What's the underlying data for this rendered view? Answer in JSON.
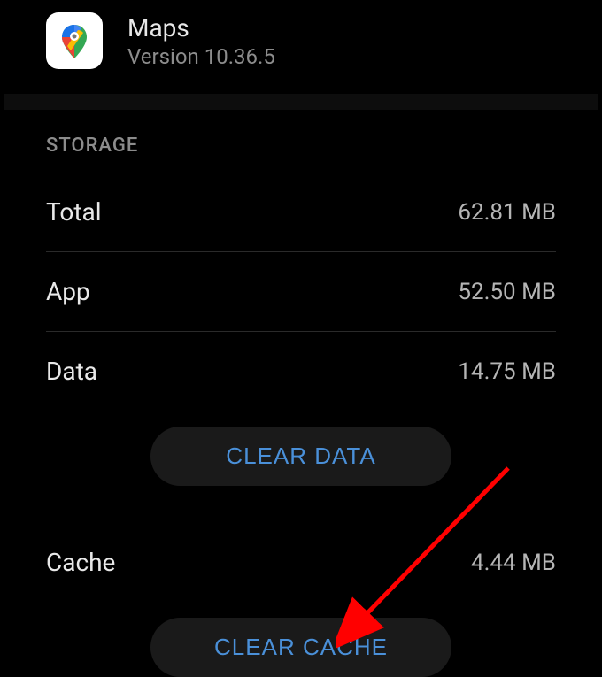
{
  "header": {
    "app_name": "Maps",
    "version_text": "Version 10.36.5"
  },
  "section": {
    "title": "STORAGE"
  },
  "storage": {
    "total_label": "Total",
    "total_value": "62.81 MB",
    "app_label": "App",
    "app_value": "52.50 MB",
    "data_label": "Data",
    "data_value": "14.75 MB",
    "cache_label": "Cache",
    "cache_value": "4.44 MB"
  },
  "actions": {
    "clear_data_label": "CLEAR DATA",
    "clear_cache_label": "CLEAR CACHE"
  }
}
